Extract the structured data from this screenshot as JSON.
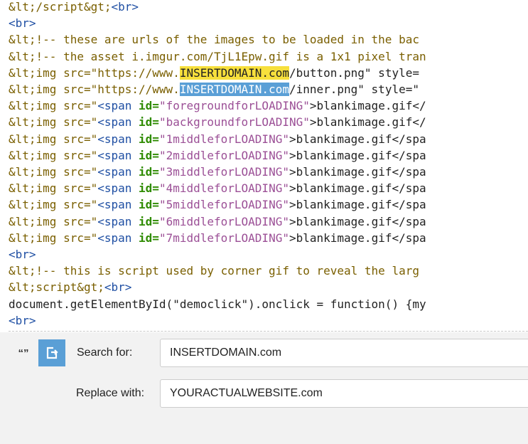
{
  "code_lines": [
    [
      {
        "t": "&lt;/script&gt;",
        "c": "tag"
      },
      {
        "t": "<br>",
        "c": "br"
      }
    ],
    [
      {
        "t": "<br>",
        "c": "br"
      }
    ],
    [
      {
        "t": "&lt;!-- these are urls of the images to be loaded in the bac",
        "c": "tag"
      }
    ],
    [
      {
        "t": "&lt;!-- the asset i.imgur.com/TjL1Epw.gif is a 1x1 pixel tran",
        "c": "tag"
      }
    ],
    [
      {
        "t": "&lt;img src=\"https://www.",
        "c": "tag"
      },
      {
        "t": "INSERTDOMAIN.com",
        "c": "hl-yellow"
      },
      {
        "t": "/button.png\" style=",
        "c": "plain"
      }
    ],
    [
      {
        "t": "&lt;img src=\"https://www.",
        "c": "tag"
      },
      {
        "t": "INSERTDOMAIN.com",
        "c": "hl-blue"
      },
      {
        "t": "/inner.png\" style=\"",
        "c": "plain"
      }
    ],
    [
      {
        "t": "&lt;img src=\"",
        "c": "tag"
      },
      {
        "t": "<span ",
        "c": "kw"
      },
      {
        "t": "id=",
        "c": "attr"
      },
      {
        "t": "\"foregroundforLOADING\"",
        "c": "str"
      },
      {
        "t": ">blankimage.gif</",
        "c": "plain"
      }
    ],
    [
      {
        "t": "&lt;img src=\"",
        "c": "tag"
      },
      {
        "t": "<span ",
        "c": "kw"
      },
      {
        "t": "id=",
        "c": "attr"
      },
      {
        "t": "\"backgroundforLOADING\"",
        "c": "str"
      },
      {
        "t": ">blankimage.gif</",
        "c": "plain"
      }
    ],
    [
      {
        "t": "&lt;img src=\"",
        "c": "tag"
      },
      {
        "t": "<span ",
        "c": "kw"
      },
      {
        "t": "id=",
        "c": "attr"
      },
      {
        "t": "\"1middleforLOADING\"",
        "c": "str"
      },
      {
        "t": ">blankimage.gif</spa",
        "c": "plain"
      }
    ],
    [
      {
        "t": "&lt;img src=\"",
        "c": "tag"
      },
      {
        "t": "<span ",
        "c": "kw"
      },
      {
        "t": "id=",
        "c": "attr"
      },
      {
        "t": "\"2middleforLOADING\"",
        "c": "str"
      },
      {
        "t": ">blankimage.gif</spa",
        "c": "plain"
      }
    ],
    [
      {
        "t": "&lt;img src=\"",
        "c": "tag"
      },
      {
        "t": "<span ",
        "c": "kw"
      },
      {
        "t": "id=",
        "c": "attr"
      },
      {
        "t": "\"3middleforLOADING\"",
        "c": "str"
      },
      {
        "t": ">blankimage.gif</spa",
        "c": "plain"
      }
    ],
    [
      {
        "t": "&lt;img src=\"",
        "c": "tag"
      },
      {
        "t": "<span ",
        "c": "kw"
      },
      {
        "t": "id=",
        "c": "attr"
      },
      {
        "t": "\"4middleforLOADING\"",
        "c": "str"
      },
      {
        "t": ">blankimage.gif</spa",
        "c": "plain"
      }
    ],
    [
      {
        "t": "&lt;img src=\"",
        "c": "tag"
      },
      {
        "t": "<span ",
        "c": "kw"
      },
      {
        "t": "id=",
        "c": "attr"
      },
      {
        "t": "\"5middleforLOADING\"",
        "c": "str"
      },
      {
        "t": ">blankimage.gif</spa",
        "c": "plain"
      }
    ],
    [
      {
        "t": "&lt;img src=\"",
        "c": "tag"
      },
      {
        "t": "<span ",
        "c": "kw"
      },
      {
        "t": "id=",
        "c": "attr"
      },
      {
        "t": "\"6middleforLOADING\"",
        "c": "str"
      },
      {
        "t": ">blankimage.gif</spa",
        "c": "plain"
      }
    ],
    [
      {
        "t": "&lt;img src=\"",
        "c": "tag"
      },
      {
        "t": "<span ",
        "c": "kw"
      },
      {
        "t": "id=",
        "c": "attr"
      },
      {
        "t": "\"7middleforLOADING\"",
        "c": "str"
      },
      {
        "t": ">blankimage.gif</spa",
        "c": "plain"
      }
    ],
    [
      {
        "t": "<br>",
        "c": "br"
      }
    ],
    [
      {
        "t": "&lt;!-- this is script used by corner gif to reveal the larg",
        "c": "tag"
      }
    ],
    [
      {
        "t": "&lt;script&gt;",
        "c": "tag"
      },
      {
        "t": "<br>",
        "c": "br"
      }
    ],
    [
      {
        "t": "document.getElementById(\"democlick\").onclick = function() {my",
        "c": "plain"
      }
    ],
    [
      {
        "t": "<br>",
        "c": "br"
      }
    ]
  ],
  "find_panel": {
    "quote_icon_glyph": "“”",
    "search_label": "Search for:",
    "search_value": "INSERTDOMAIN.com",
    "replace_label": "Replace with:",
    "replace_value": "YOURACTUALWEBSITE.com"
  },
  "colors": {
    "accent": "#5a9fd6",
    "highlight_match": "#f7e03c",
    "panel_bg": "#f2f2f2"
  }
}
